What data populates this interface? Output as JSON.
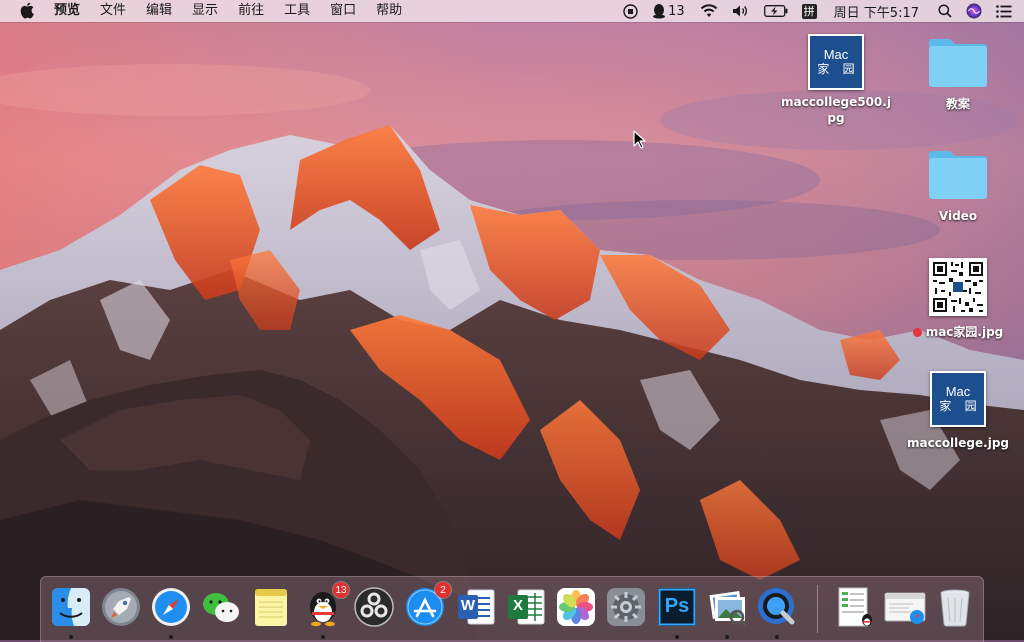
{
  "menubar": {
    "app_name": "预览",
    "menus": [
      "文件",
      "编辑",
      "显示",
      "前往",
      "工具",
      "窗口",
      "帮助"
    ],
    "qq_count": "13",
    "ime_label": "拼",
    "clock": "周日 下午5:17"
  },
  "desktop": {
    "icons": [
      {
        "label": "maccollege500.jpg",
        "thumb_top": "Mac",
        "thumb_bottom": "家 园"
      },
      {
        "label": "教案"
      },
      {
        "label": "Video"
      },
      {
        "label": "mac家园.jpg"
      },
      {
        "label": "maccollege.jpg",
        "thumb_top": "Mac",
        "thumb_bottom": "家 园"
      }
    ]
  },
  "dock": {
    "qq_badge": "13",
    "appstore_badge": "2",
    "word_letter": "W",
    "excel_letter": "X",
    "ps_letter": "Ps"
  },
  "colors": {
    "folder": "#6ec6f0",
    "dock_indicator": "#1a1a1a",
    "badge": "#e0312f"
  }
}
